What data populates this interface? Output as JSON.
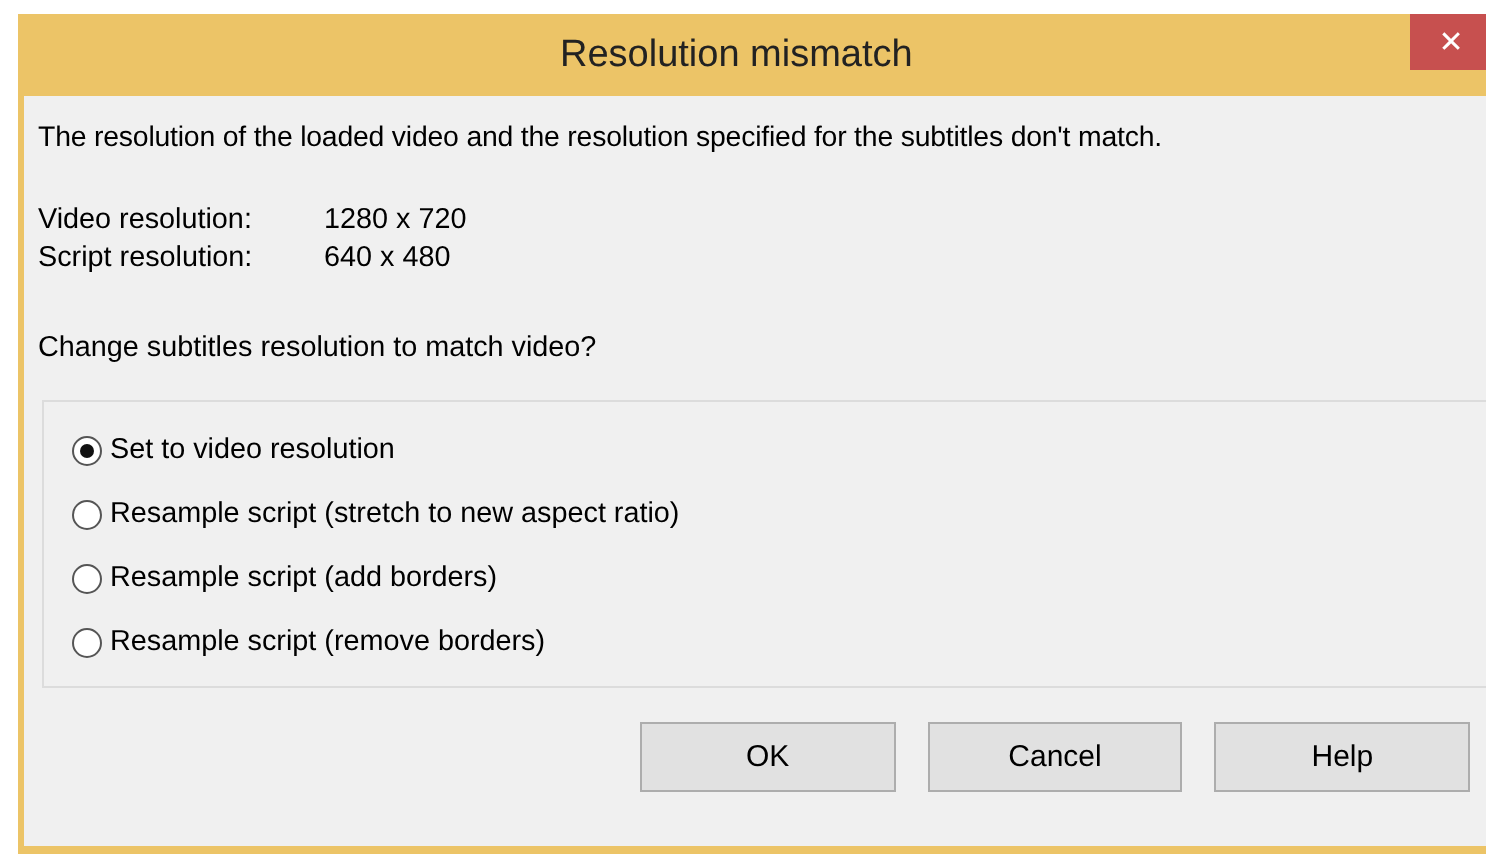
{
  "window": {
    "title": "Resolution mismatch",
    "close": "✕"
  },
  "message": "The resolution of the loaded video and the resolution specified for the subtitles don't match.",
  "details": [
    {
      "label": "Video resolution:",
      "value": "1280 x 720"
    },
    {
      "label": "Script resolution:",
      "value": "640 x 480"
    }
  ],
  "question": "Change subtitles resolution to match video?",
  "options": [
    {
      "label": "Set to video resolution",
      "selected": true
    },
    {
      "label": "Resample script (stretch to new aspect ratio)",
      "selected": false
    },
    {
      "label": "Resample script (add borders)",
      "selected": false
    },
    {
      "label": "Resample script (remove borders)",
      "selected": false
    }
  ],
  "buttons": [
    "OK",
    "Cancel",
    "Help"
  ]
}
